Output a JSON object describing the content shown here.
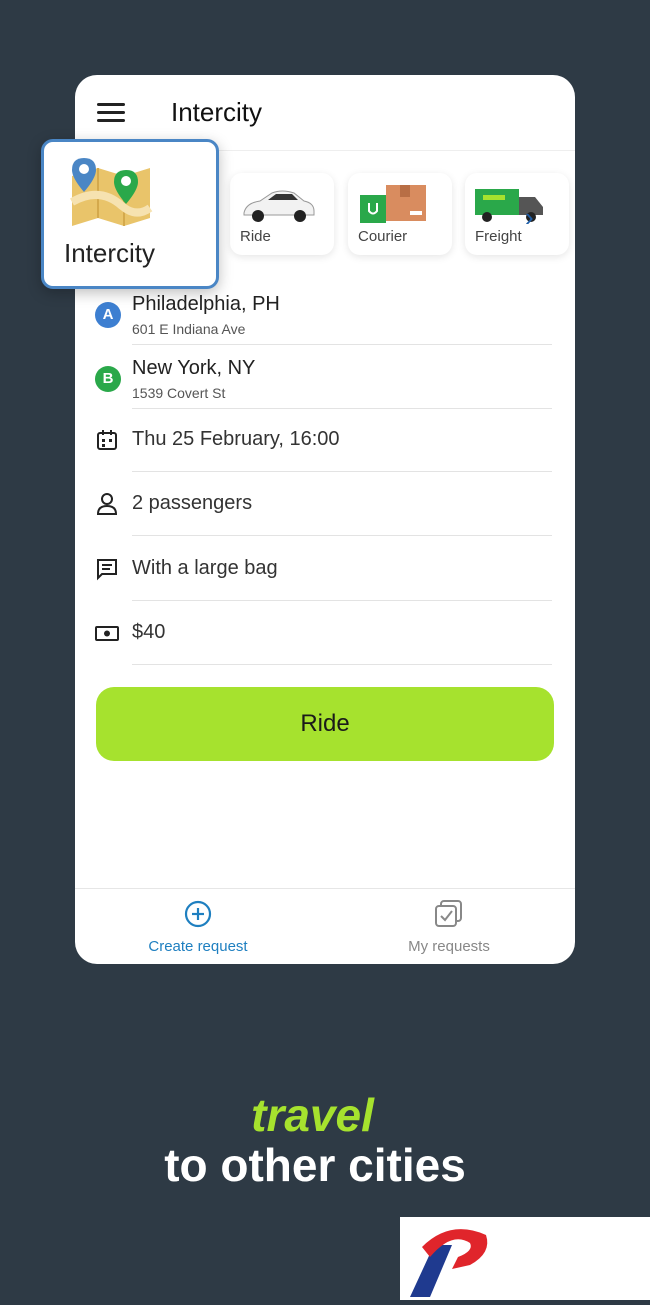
{
  "header": {
    "title": "Intercity"
  },
  "popup": {
    "label": "Intercity"
  },
  "services": [
    {
      "label": "Ride",
      "icon": "car-icon"
    },
    {
      "label": "Courier",
      "icon": "courier-box-icon"
    },
    {
      "label": "Freight",
      "icon": "truck-icon"
    }
  ],
  "route": {
    "from": {
      "badge": "A",
      "city": "Philadelphia, PH",
      "street": "601 E Indiana Ave"
    },
    "to": {
      "badge": "B",
      "city": "New York, NY",
      "street": "1539 Covert St"
    }
  },
  "details": {
    "datetime": "Thu 25 February, 16:00",
    "passengers": "2 passengers",
    "comment": "With a large bag",
    "price": "$40"
  },
  "actions": {
    "ride_label": "Ride"
  },
  "bottom_nav": [
    {
      "label": "Create request",
      "icon": "plus-circle-icon",
      "active": true
    },
    {
      "label": "My requests",
      "icon": "requests-icon",
      "active": false
    }
  ],
  "slogan": {
    "line1": "travel",
    "line2": "to other cities"
  },
  "colors": {
    "accent": "#a6e22e",
    "background": "#2e3a45",
    "link": "#1e5ea8",
    "badge_a": "#3d7fd1",
    "badge_b": "#2aa84a"
  }
}
